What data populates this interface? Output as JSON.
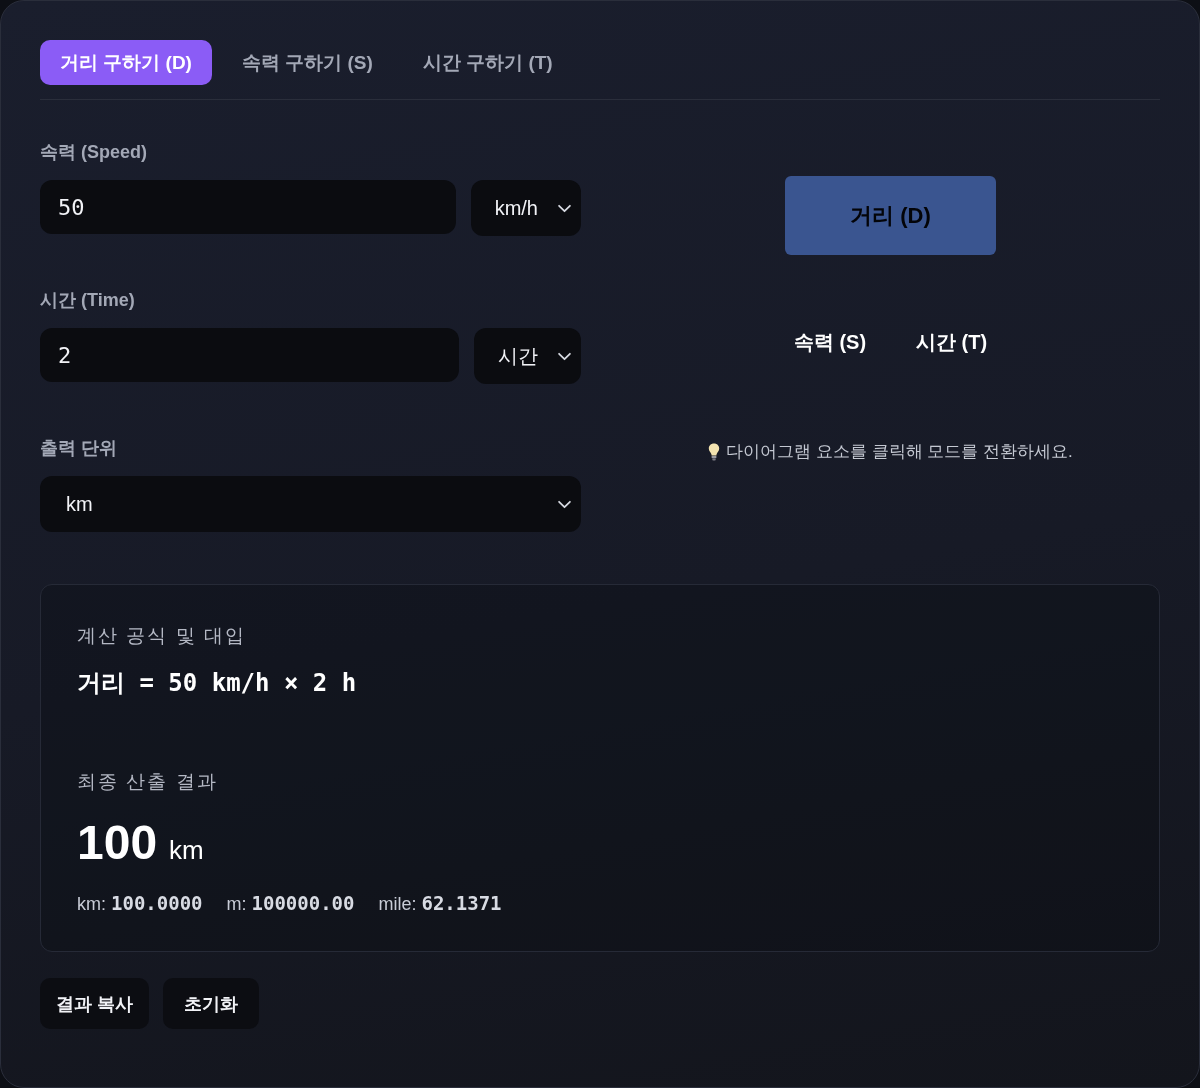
{
  "tabs": [
    {
      "label": "거리 구하기 (D)",
      "selected": true
    },
    {
      "label": "속력 구하기 (S)",
      "selected": false
    },
    {
      "label": "시간 구하기 (T)",
      "selected": false
    }
  ],
  "form": [
    {
      "kind": "number",
      "label": "속력 (Speed)",
      "value": "50",
      "unit": "km/h"
    },
    {
      "kind": "number",
      "label": "시간 (Time)",
      "value": "2",
      "unit": "시간"
    },
    {
      "kind": "select",
      "label": "출력 단위",
      "value": "km"
    }
  ],
  "diagram": {
    "nodes": [
      {
        "label": "거리 (D)",
        "selected": true
      },
      {
        "label": "속력 (S)",
        "selected": false
      },
      {
        "label": "시간 (T)",
        "selected": false
      }
    ],
    "hint": "다이어그램 요소를 클릭해 모드를 전환하세요."
  },
  "result": {
    "formula_label": "계산 공식 및 대입",
    "formula": "거리 = 50 km/h × 2 h",
    "result_label": "최종 산출 결과",
    "value": "100",
    "unit": "km",
    "conversions": [
      {
        "label": "km:",
        "value": "100.0000"
      },
      {
        "label": "m:",
        "value": "100000.00"
      },
      {
        "label": "mile:",
        "value": "62.1371"
      }
    ]
  },
  "actions": [
    "결과 복사",
    "초기화"
  ]
}
